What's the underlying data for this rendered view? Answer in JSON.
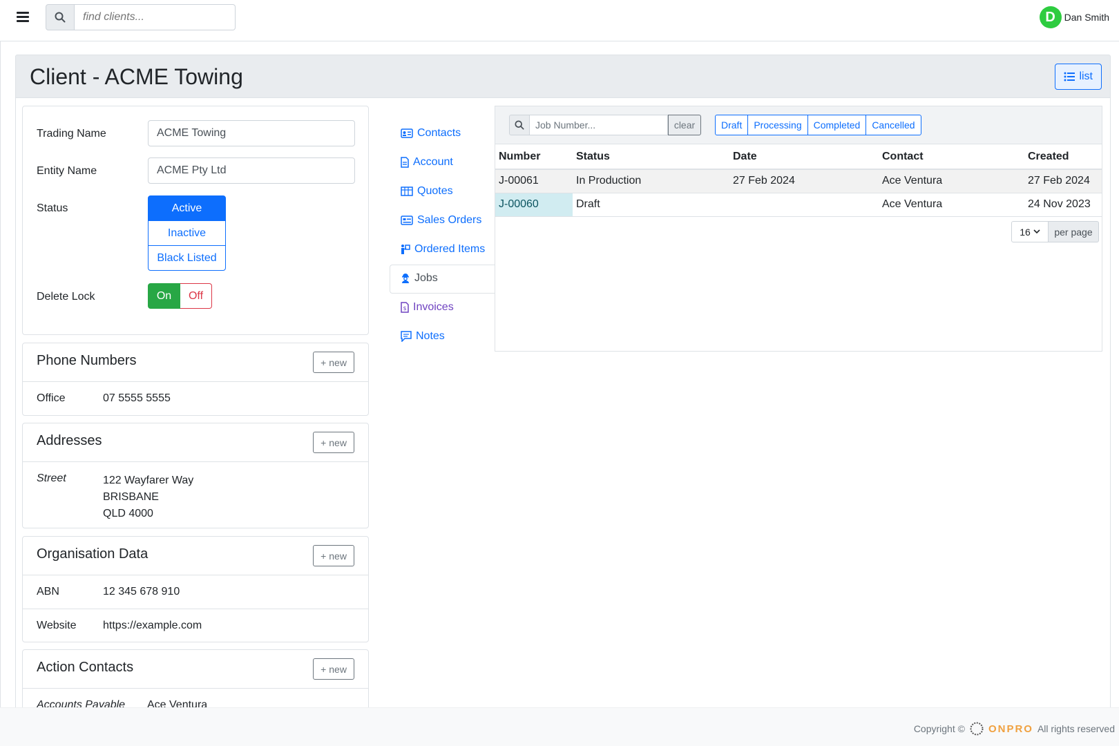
{
  "topbar": {
    "search_placeholder": "find clients...",
    "user_initial": "D",
    "user_name": "Dan Smith"
  },
  "header": {
    "title": "Client - ACME Towing",
    "list_label": "list"
  },
  "details": {
    "trading_name_label": "Trading Name",
    "trading_name_value": "ACME Towing",
    "entity_name_label": "Entity Name",
    "entity_name_value": "ACME Pty Ltd",
    "status_label": "Status",
    "status_options": [
      "Active",
      "Inactive",
      "Black Listed"
    ],
    "status_selected": "Active",
    "delete_lock_label": "Delete Lock",
    "delete_lock_on": "On",
    "delete_lock_off": "Off"
  },
  "phone_numbers": {
    "title": "Phone Numbers",
    "new_label": "new",
    "items": [
      {
        "label": "Office",
        "value": "07 5555 5555"
      }
    ]
  },
  "addresses": {
    "title": "Addresses",
    "new_label": "new",
    "type": "Street",
    "lines": [
      "122 Wayfarer Way",
      "BRISBANE",
      "QLD 4000"
    ]
  },
  "organisation": {
    "title": "Organisation Data",
    "new_label": "new",
    "items": [
      {
        "label": "ABN",
        "value": "12 345 678 910"
      },
      {
        "label": "Website",
        "value": "https://example.com"
      }
    ]
  },
  "action_contacts": {
    "title": "Action Contacts",
    "new_label": "new",
    "items": [
      {
        "label": "Accounts Payable",
        "value": "Ace Ventura"
      }
    ]
  },
  "nav": {
    "items": [
      "Contacts",
      "Account",
      "Quotes",
      "Sales Orders",
      "Ordered Items",
      "Jobs",
      "Invoices",
      "Notes"
    ],
    "active": "Jobs"
  },
  "jobs": {
    "search_placeholder": "Job Number...",
    "clear_label": "clear",
    "filters": [
      "Draft",
      "Processing",
      "Completed",
      "Cancelled"
    ],
    "columns": [
      "Number",
      "Status",
      "Date",
      "Contact",
      "Created"
    ],
    "rows": [
      [
        "J-00061",
        "In Production",
        "27 Feb 2024",
        "Ace Ventura",
        "27 Feb 2024"
      ],
      [
        "J-00060",
        "Draft",
        "",
        "Ace Ventura",
        "24 Nov 2023"
      ]
    ],
    "per_page_value": "16",
    "per_page_label": "per page"
  },
  "footer": {
    "copyright": "Copyright ©",
    "brand": "ONPRO",
    "rights": "All rights reserved"
  },
  "colors": {
    "primary": "#0d6efd",
    "success": "#28a745",
    "danger": "#dc3545",
    "avatar": "#2ecc40",
    "brand": "#f0a140"
  }
}
